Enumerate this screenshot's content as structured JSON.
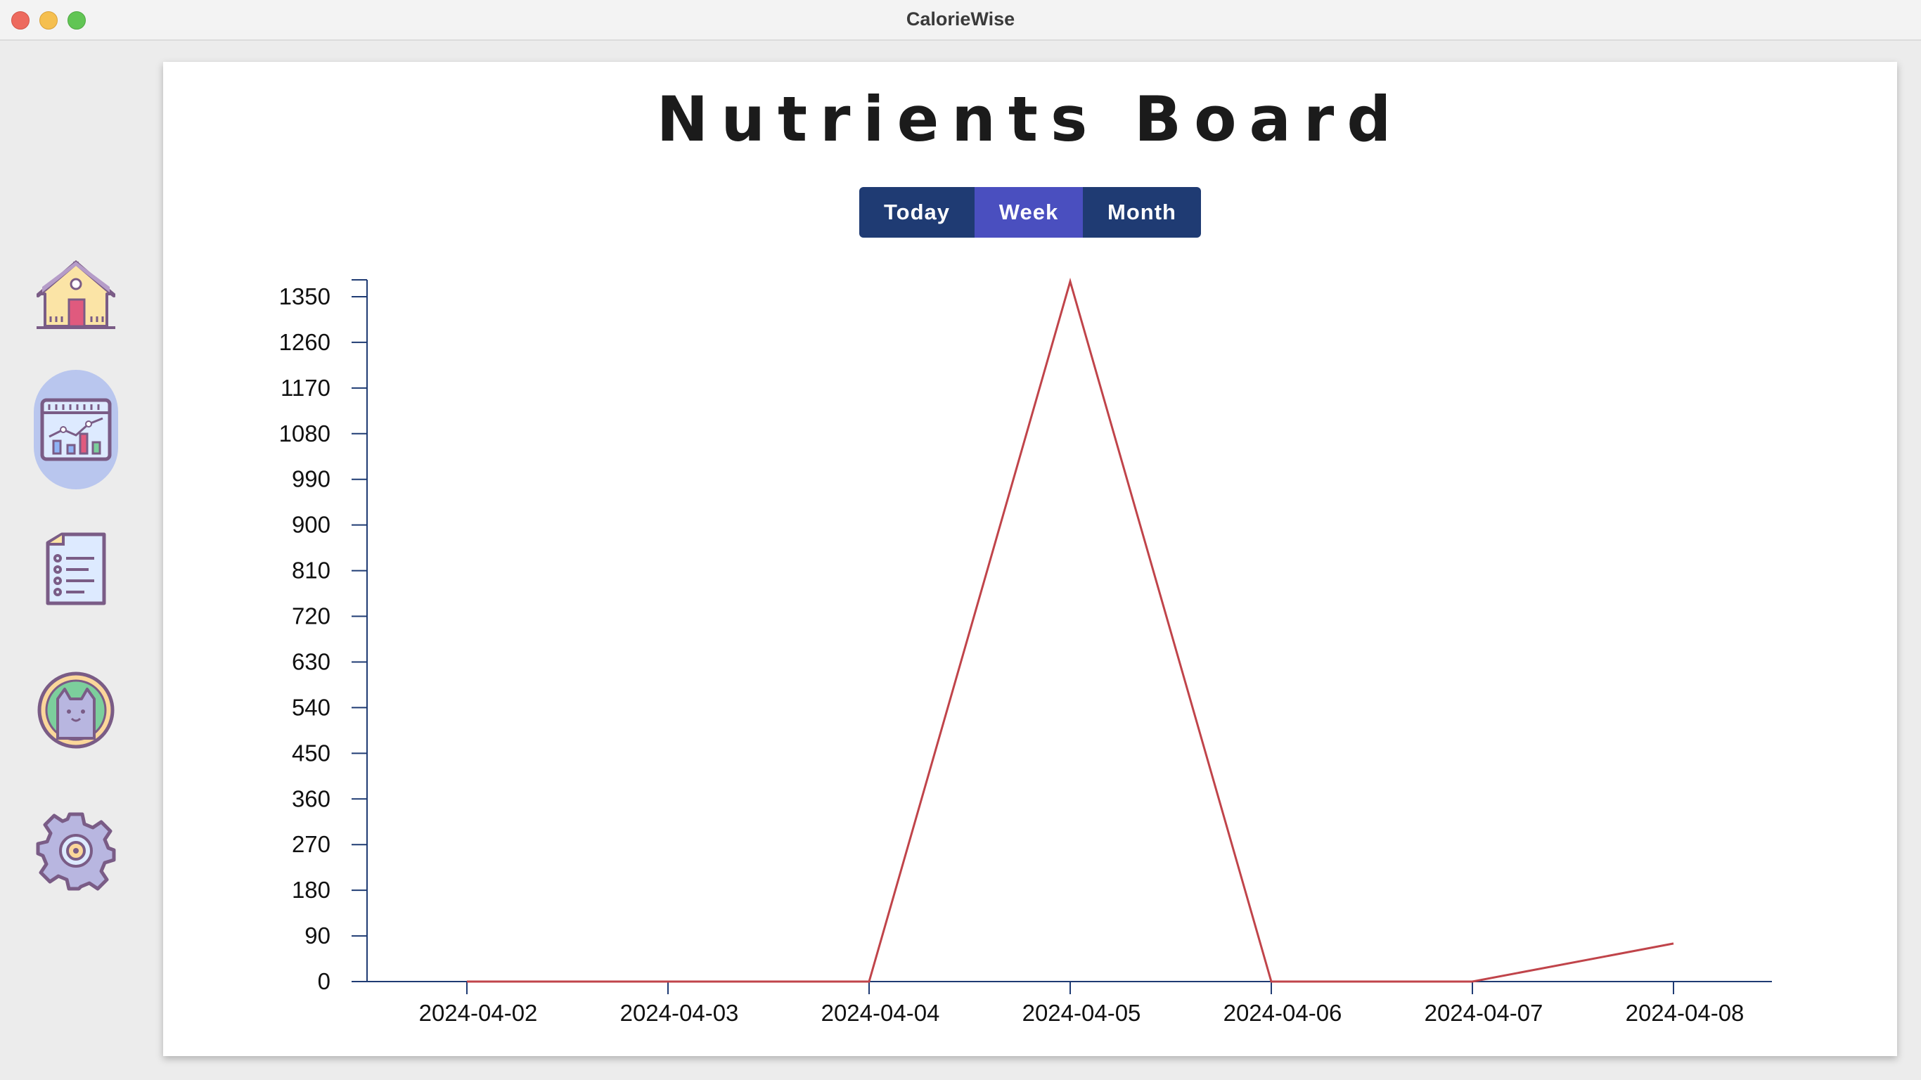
{
  "window": {
    "title": "CalorieWise"
  },
  "sidebar": {
    "items": [
      {
        "name": "home",
        "icon": "house-icon",
        "active": false
      },
      {
        "name": "dashboard",
        "icon": "chart-board-icon",
        "active": true
      },
      {
        "name": "log",
        "icon": "checklist-icon",
        "active": false
      },
      {
        "name": "profile",
        "icon": "cat-avatar-icon",
        "active": false
      },
      {
        "name": "settings",
        "icon": "gear-icon",
        "active": false
      }
    ]
  },
  "board": {
    "title": "Nutrients Board",
    "ranges": [
      "Today",
      "Week",
      "Month"
    ],
    "selected_range": "Week"
  },
  "colors": {
    "line": "#c0444a",
    "axis": "#1f3b73",
    "button": "#1f3b73",
    "button_active": "#4a4fbf"
  },
  "chart_data": {
    "type": "line",
    "x": [
      "2024-04-02",
      "2024-04-03",
      "2024-04-04",
      "2024-04-05",
      "2024-04-06",
      "2024-04-07",
      "2024-04-08"
    ],
    "values": [
      0,
      0,
      0,
      1380,
      0,
      0,
      75
    ],
    "yticks": [
      0,
      90,
      180,
      270,
      360,
      450,
      540,
      630,
      720,
      810,
      900,
      990,
      1080,
      1170,
      1260,
      1350
    ],
    "ylim": [
      0,
      1380
    ],
    "grid": false
  }
}
